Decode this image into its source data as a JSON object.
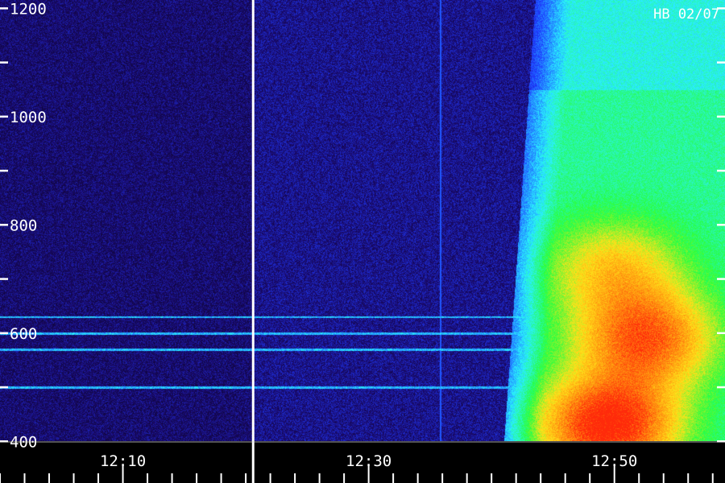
{
  "chart_data": {
    "type": "heatmap",
    "label": "HB 02/07",
    "y_ticks": [
      400,
      600,
      800,
      1000,
      1200
    ],
    "ylim": [
      390,
      1205
    ],
    "y_minor_step": 100,
    "x_ticks": [
      "12:10",
      "12:30",
      "12:50"
    ],
    "x_tick_minutes": [
      730,
      750,
      770
    ],
    "xlim_minutes": [
      720,
      779
    ],
    "x_minor_step_minutes": 2,
    "gap_marker_minutes": 740.6,
    "colors": {
      "background": "#000000",
      "noise": "#1a0a6e",
      "blue": "#1e3cff",
      "cyan": "#2af0ff",
      "green": "#28ff40",
      "yellow": "#ffe31a",
      "orange": "#ff9a10",
      "red": "#ff2a0a",
      "axis": "#ffffff"
    },
    "features": [
      {
        "kind": "burst",
        "t_start": 762.5,
        "t_end": 779,
        "f_low": 390,
        "f_high": 1205
      },
      {
        "kind": "hotspot",
        "t_center": 769.5,
        "f_center": 430,
        "intensity": "red"
      },
      {
        "kind": "hotspot",
        "t_center": 772.5,
        "f_center": 590,
        "intensity": "orange"
      },
      {
        "kind": "hotspot",
        "t_center": 770,
        "f_center": 720,
        "intensity": "green"
      },
      {
        "kind": "line",
        "f": 500
      },
      {
        "kind": "line",
        "f": 570
      },
      {
        "kind": "line",
        "f": 630
      },
      {
        "kind": "line",
        "f": 600
      },
      {
        "kind": "spike",
        "t": 755.8
      }
    ]
  }
}
